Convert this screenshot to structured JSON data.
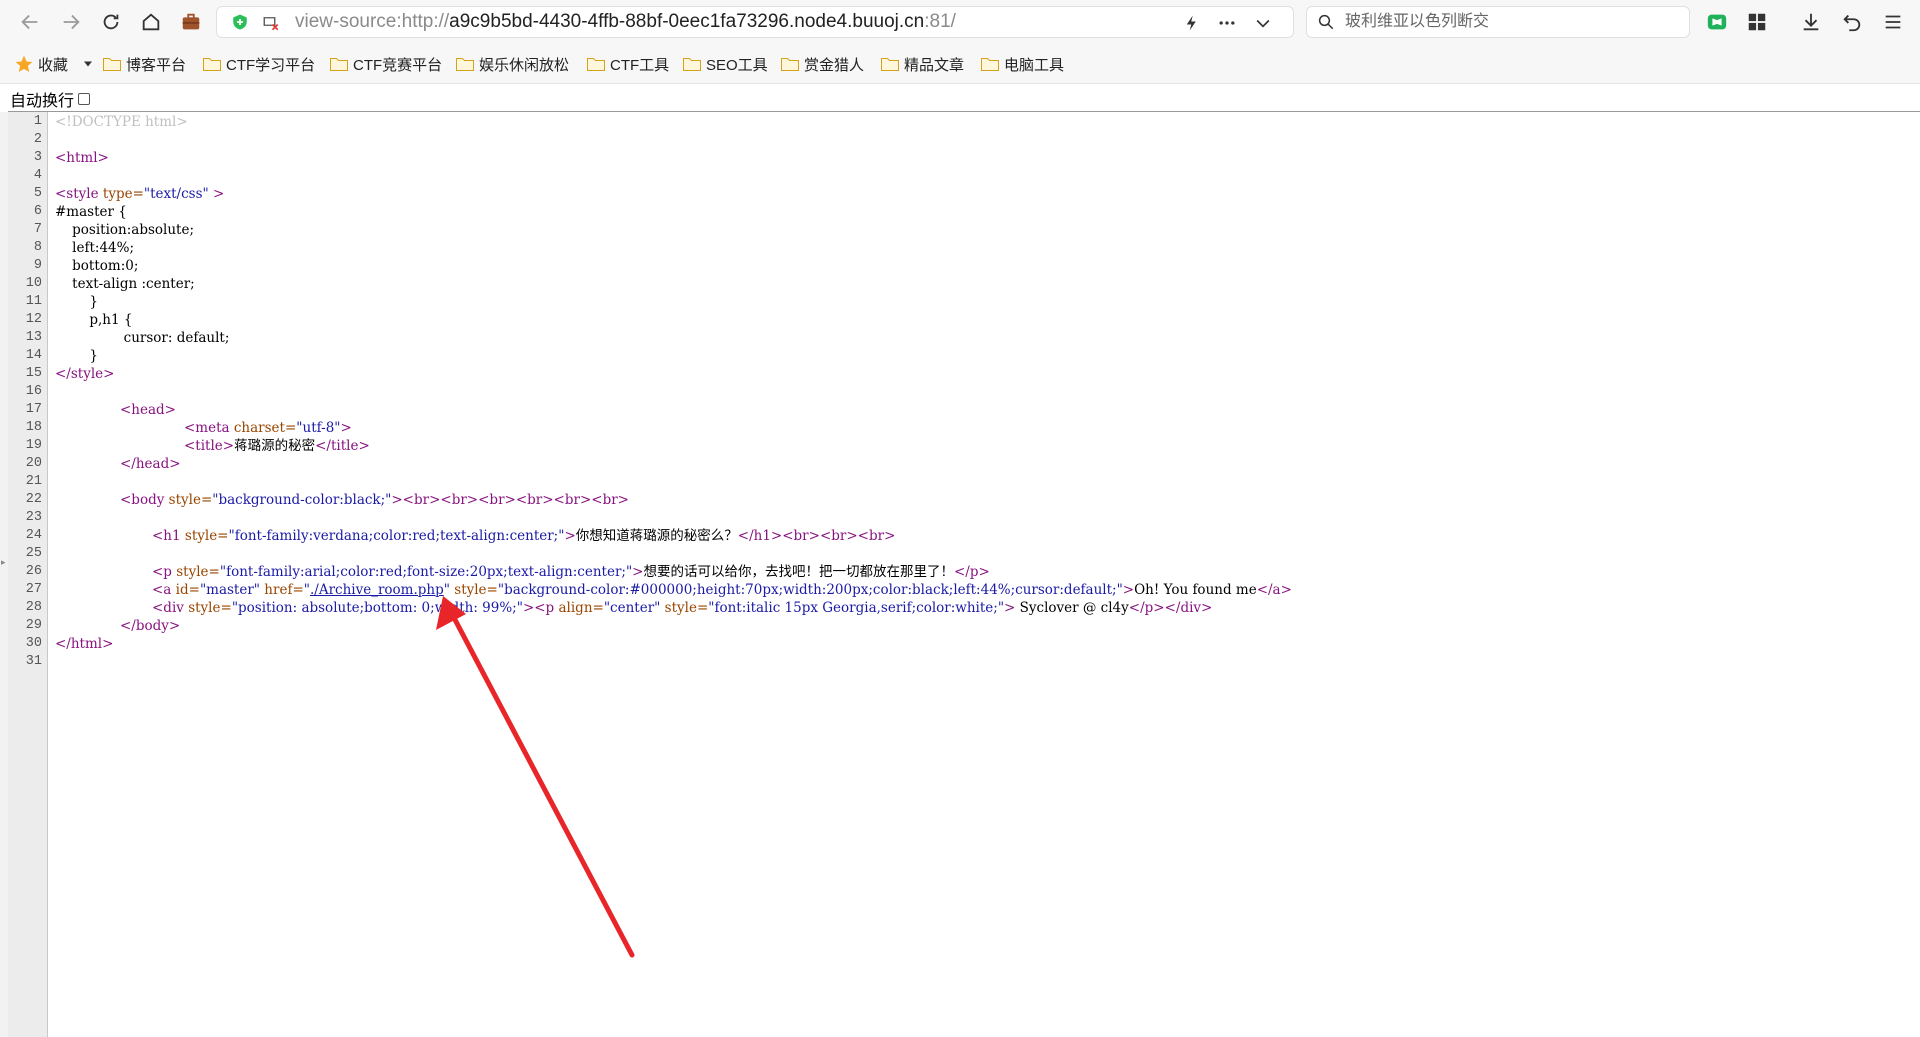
{
  "browser": {
    "url": {
      "prefix": "view-source:http://",
      "host": "a9c9b5bd-4430-4ffb-88bf-0eec1fa73296.node4.buuoj.cn",
      "port": ":81/"
    },
    "search_placeholder": "玻利维亚以色列断交",
    "icons": [
      "back-icon",
      "forward-icon",
      "reload-icon",
      "home-icon",
      "briefcase-icon",
      "shield-icon",
      "insecure-icon",
      "lightning-icon",
      "more-icon",
      "chevron-down-icon",
      "search-icon",
      "reader-icon",
      "grid-icon",
      "download-icon",
      "undo-icon",
      "menu-icon"
    ]
  },
  "bookmarks": {
    "favorites_label": "收藏",
    "items": [
      "博客平台",
      "CTF学习平台",
      "CTF竞赛平台",
      "娱乐休闲放松",
      "CTF工具",
      "SEO工具",
      "赏金猎人",
      "精品文章",
      "电脑工具"
    ]
  },
  "wrap_label": "自动换行",
  "source": {
    "line_numbers": [
      "1",
      "2",
      "3",
      "4",
      "5",
      "6",
      "7",
      "8",
      "9",
      "10",
      "11",
      "12",
      "13",
      "14",
      "15",
      "16",
      "17",
      "18",
      "19",
      "20",
      "21",
      "22",
      "23",
      "24",
      "25",
      "26",
      "27",
      "28",
      "29",
      "30",
      "31"
    ],
    "lines": {
      "l1": "<!DOCTYPE html>",
      "l3": "<html>",
      "l5_tag": "<style ",
      "l5_attr": "type=",
      "l5_val": "\"text/css\"",
      "l5_end": " >",
      "l6": "#master {",
      "l7": "    position:absolute;",
      "l8": "    left:44%;",
      "l9": "    bottom:0;",
      "l10": "    text-align :center;",
      "l11": "        }",
      "l12": "        p,h1 {",
      "l13": "                cursor: default;",
      "l14": "        }",
      "l15": "</style>",
      "l17": "<head>",
      "l18_tag": "<meta ",
      "l18_attr": "charset=",
      "l18_val": "\"utf-8\"",
      "l18_end": ">",
      "l19_open": "<title>",
      "l19_text": "蒋璐源的秘密",
      "l19_close": "</title>",
      "l20": "</head>",
      "l22_tag": "<body ",
      "l22_attr": "style=",
      "l22_val": "\"background-color:black;\"",
      "l22_end": "><br><br><br><br><br><br>",
      "l24_tag": "<h1 ",
      "l24_attr": "style=",
      "l24_val": "\"font-family:verdana;color:red;text-align:center;\"",
      "l24_gt": ">",
      "l24_text": "你想知道蒋璐源的秘密么？",
      "l24_end": "</h1><br><br><br>",
      "l26_tag": "<p ",
      "l26_attr": "style=",
      "l26_val": "\"font-family:arial;color:red;font-size:20px;text-align:center;\"",
      "l26_gt": ">",
      "l26_text": "想要的话可以给你，去找吧！把一切都放在那里了！",
      "l26_end": "</p>",
      "l27_tag": "<a ",
      "l27_attr1": "id=",
      "l27_val1": "\"master\"",
      "l27_attr2": " href=",
      "l27_q1": "\"",
      "l27_link": "./Archive_room.php",
      "l27_q2": "\"",
      "l27_attr3": " style=",
      "l27_val3": "\"background-color:#000000;height:70px;width:200px;color:black;left:44%;cursor:default;\"",
      "l27_gt": ">",
      "l27_text": "Oh! You found me",
      "l27_end": "</a>",
      "l28_tag": "<div ",
      "l28_attr": "style=",
      "l28_val": "\"position: absolute;bottom: 0;width: 99%;\"",
      "l28_mid": "><p ",
      "l28_attr2": "align=",
      "l28_val2": "\"center\"",
      "l28_attr3": " style=",
      "l28_val3": "\"font:italic 15px Georgia,serif;color:white;\"",
      "l28_gt": ">",
      "l28_text": " Syclover @ cl4y",
      "l28_end": "</p></div>",
      "l29": "</body>",
      "l30": "</html>"
    }
  },
  "annotation": {
    "color": "#e8262a"
  }
}
